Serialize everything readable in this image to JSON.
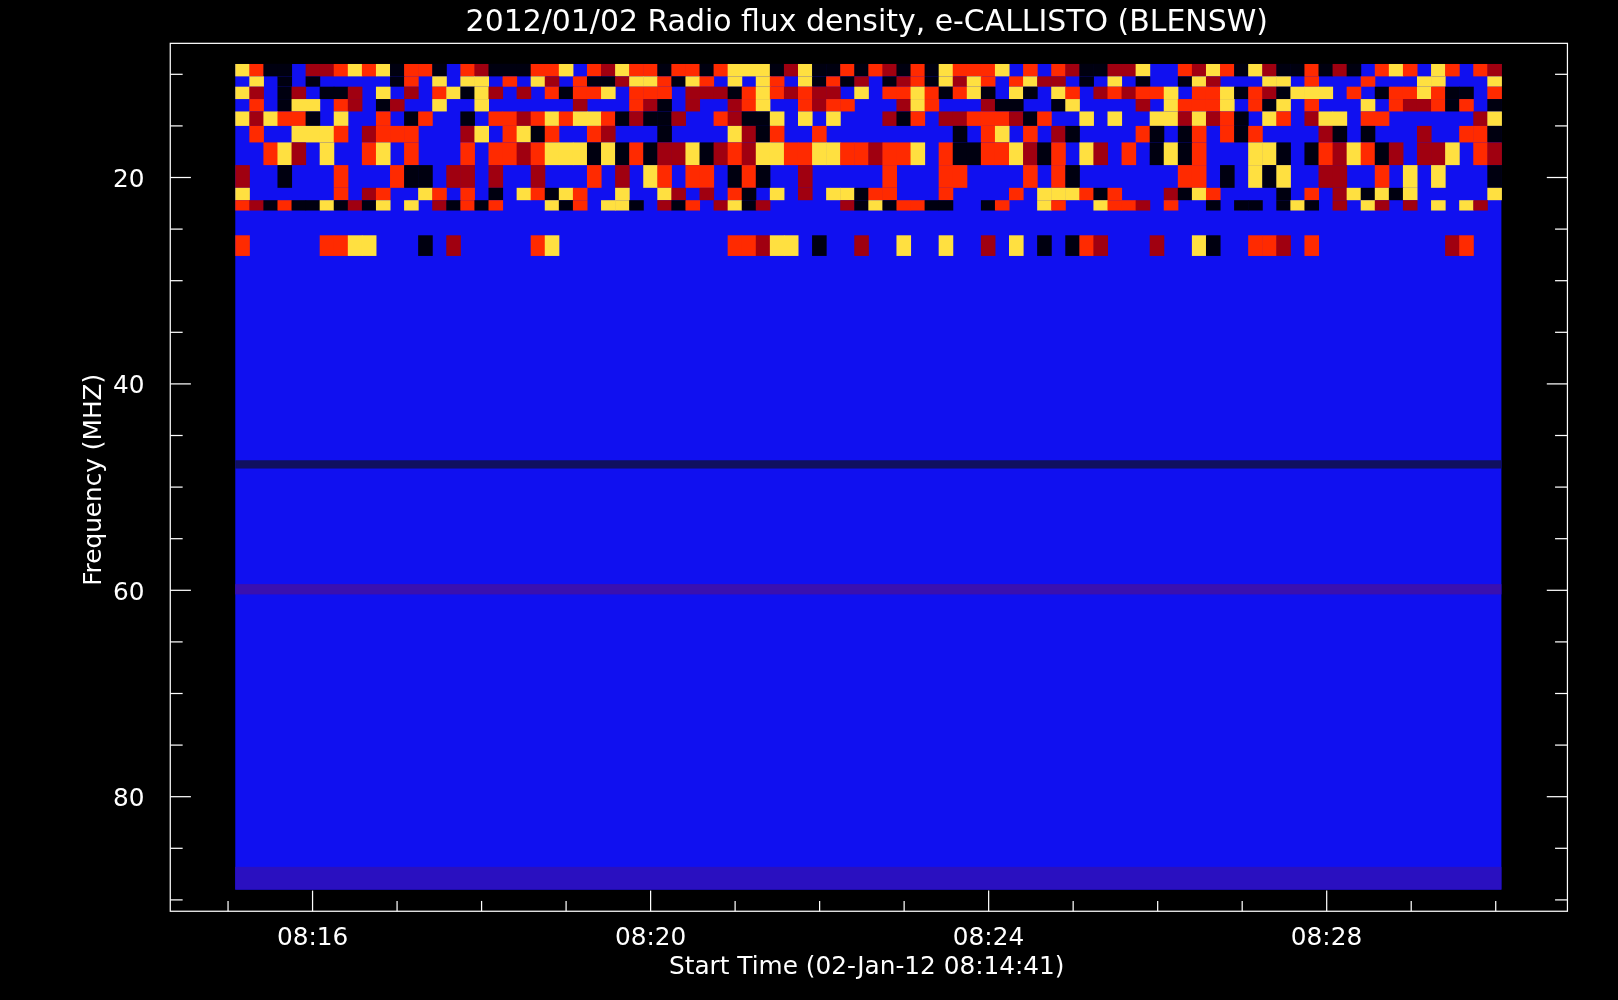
{
  "chart": {
    "title": "2012/01/02  Radio flux density, e-CALLISTO (BLENSW)",
    "ylabel": "Frequency (MHZ)",
    "xlabel": "Start Time (02-Jan-12 08:14:41)",
    "yticks": [
      {
        "label": "20"
      },
      {
        "label": "40"
      },
      {
        "label": "60"
      },
      {
        "label": "80"
      }
    ],
    "xticks": [
      {
        "label": "08:16"
      },
      {
        "label": "08:20"
      },
      {
        "label": "08:24"
      },
      {
        "label": "08:28"
      }
    ]
  }
}
